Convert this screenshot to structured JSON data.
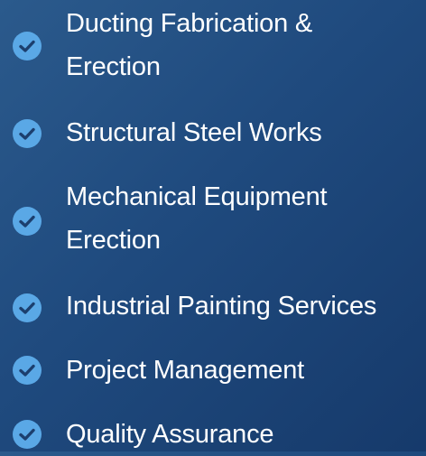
{
  "services": {
    "icon": "check-circle-icon",
    "icon_color": "#5aa8e6",
    "check_color": "#1c3f6e",
    "text_color": "#ffffff",
    "items": [
      {
        "line1": "Ducting Fabrication &",
        "line2": "Erection"
      },
      {
        "line1": "Structural Steel Works"
      },
      {
        "line1": "Mechanical Equipment",
        "line2": "Erection"
      },
      {
        "line1": "Industrial Painting Services"
      },
      {
        "line1": "Project Management"
      },
      {
        "line1": "Quality Assurance"
      }
    ]
  }
}
